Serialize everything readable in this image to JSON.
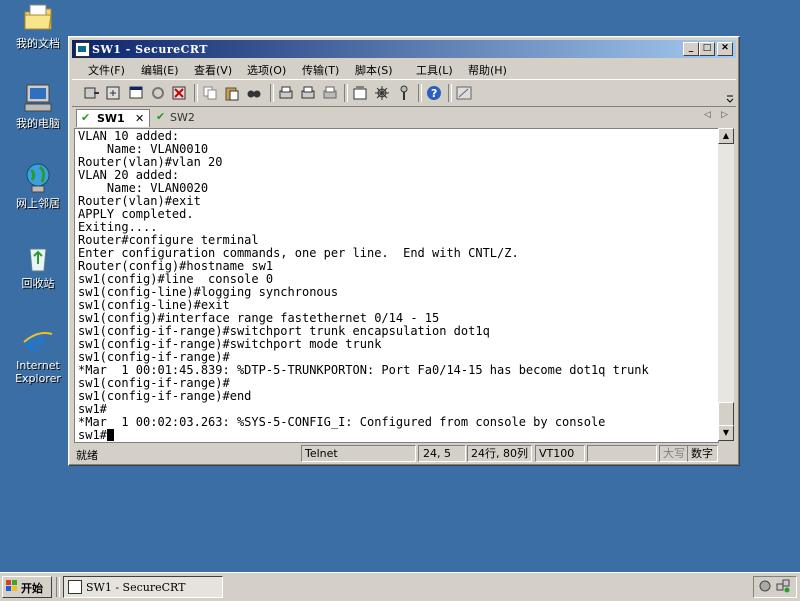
{
  "desktop": {
    "icons": [
      {
        "label": "我的文档"
      },
      {
        "label": "我的电脑"
      },
      {
        "label": "网上邻居"
      },
      {
        "label": "回收站"
      },
      {
        "label_line1": "Internet",
        "label_line2": "Explorer"
      }
    ]
  },
  "window": {
    "title": "SW1 - SecureCRT",
    "menu": [
      "文件(F)",
      "编辑(E)",
      "查看(V)",
      "选项(O)",
      "传输(T)",
      "脚本(S)",
      "工具(L)",
      "帮助(H)"
    ],
    "tabs": [
      {
        "label": "SW1",
        "close": "✕"
      },
      {
        "label": "SW2"
      }
    ],
    "terminal_lines": [
      "VLAN 10 added:",
      "    Name: VLAN0010",
      "Router(vlan)#vlan 20",
      "VLAN 20 added:",
      "    Name: VLAN0020",
      "Router(vlan)#exit",
      "APPLY completed.",
      "Exiting....",
      "Router#configure terminal",
      "Enter configuration commands, one per line.  End with CNTL/Z.",
      "Router(config)#hostname sw1",
      "sw1(config)#line  console 0",
      "sw1(config-line)#logging synchronous",
      "sw1(config-line)#exit",
      "sw1(config)#interface range fastethernet 0/14 - 15",
      "sw1(config-if-range)#switchport trunk encapsulation dot1q",
      "sw1(config-if-range)#switchport mode trunk",
      "sw1(config-if-range)#",
      "*Mar  1 00:01:45.839: %DTP-5-TRUNKPORTON: Port Fa0/14-15 has become dot1q trunk",
      "sw1(config-if-range)#",
      "sw1(config-if-range)#end",
      "sw1#",
      "*Mar  1 00:02:03.263: %SYS-5-CONFIG_I: Configured from console by console"
    ],
    "prompt": "sw1#",
    "status": {
      "ready": "就绪",
      "protocol": "Telnet",
      "position": "24,  5",
      "size": "24行, 80列",
      "emulation": "VT100",
      "caps": "大写",
      "num": "数字"
    }
  },
  "taskbar": {
    "start": "开始",
    "task_title": "SW1 - SecureCRT"
  },
  "colors": {
    "desktop": "#3a6ea5",
    "title_active_start": "#0a246a",
    "title_active_end": "#a6caf0",
    "face": "#d4d0c8",
    "tab_check": "#2a9a2a"
  }
}
